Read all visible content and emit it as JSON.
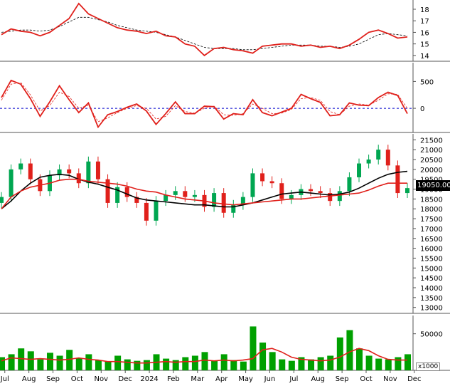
{
  "colors": {
    "price_up": "#00a651",
    "price_down": "#e0201b",
    "ma_short": "#e0201b",
    "ma_long": "#000000",
    "volume": "#00a000",
    "volume_ma": "#e0201b",
    "zero_line": "#0000cc",
    "signal": "#000000"
  },
  "x_axis": {
    "labels": [
      "Jul",
      "Aug",
      "Sep",
      "Oct",
      "Nov",
      "Dec",
      "2024",
      "Feb",
      "Mar",
      "Apr",
      "May",
      "Jun",
      "Jul",
      "Aug",
      "Sep",
      "Oct",
      "Nov",
      "Dec"
    ]
  },
  "chart_data": [
    {
      "type": "line",
      "panel": "indicator-top",
      "y_ticks": [
        "18",
        "17",
        "16",
        "15",
        "14"
      ],
      "ylim": [
        13.5,
        18.8
      ],
      "series": [
        {
          "style": "solid-red",
          "values": [
            15.8,
            16.3,
            16.1,
            16.0,
            15.7,
            16.0,
            16.6,
            17.2,
            18.5,
            17.6,
            17.2,
            16.8,
            16.4,
            16.2,
            16.1,
            15.9,
            16.1,
            15.7,
            15.6,
            15.0,
            14.8,
            14.0,
            14.6,
            14.7,
            14.5,
            14.4,
            14.2,
            14.8,
            14.9,
            15.0,
            15.0,
            14.8,
            14.9,
            14.7,
            14.8,
            14.6,
            14.9,
            15.4,
            16.0,
            16.2,
            15.9,
            15.5,
            15.6
          ]
        },
        {
          "style": "dashed-black",
          "values": [
            16.0,
            16.1,
            16.2,
            16.2,
            16.1,
            16.2,
            16.5,
            16.9,
            17.3,
            17.3,
            17.1,
            16.9,
            16.6,
            16.4,
            16.2,
            16.1,
            16.0,
            15.8,
            15.6,
            15.3,
            15.0,
            14.7,
            14.6,
            14.6,
            14.6,
            14.5,
            14.5,
            14.6,
            14.7,
            14.8,
            14.9,
            14.9,
            14.9,
            14.8,
            14.8,
            14.7,
            14.8,
            15.0,
            15.4,
            15.8,
            15.9,
            15.8,
            15.7
          ]
        }
      ]
    },
    {
      "type": "line",
      "panel": "oscillator",
      "y_ticks": [
        "500",
        "0"
      ],
      "ylim": [
        -450,
        850
      ],
      "zero": 0,
      "series": [
        {
          "style": "solid-red",
          "values": [
            200,
            520,
            450,
            180,
            -150,
            120,
            420,
            160,
            -80,
            100,
            -350,
            -120,
            -60,
            20,
            80,
            -50,
            -300,
            -100,
            120,
            -100,
            -100,
            40,
            30,
            -200,
            -100,
            -120,
            160,
            -80,
            -140,
            -70,
            0,
            260,
            180,
            110,
            -140,
            -120,
            100,
            60,
            50,
            200,
            300,
            240,
            -100
          ]
        },
        {
          "style": "dashed-red",
          "values": [
            150,
            450,
            480,
            250,
            -50,
            50,
            300,
            220,
            0,
            60,
            -250,
            -180,
            -80,
            0,
            50,
            0,
            -200,
            -150,
            50,
            -60,
            -90,
            0,
            40,
            -120,
            -130,
            -100,
            80,
            0,
            -100,
            -90,
            -20,
            180,
            200,
            150,
            -60,
            -120,
            40,
            80,
            60,
            150,
            270,
            260,
            0
          ]
        }
      ]
    },
    {
      "type": "candlestick",
      "panel": "price",
      "y_ticks": [
        "21500",
        "21000",
        "20500",
        "20000",
        "19500",
        "19000",
        "18500",
        "18000",
        "17500",
        "17000",
        "16500",
        "16000",
        "15500",
        "15000",
        "14500",
        "14000",
        "13500",
        "13000"
      ],
      "ylim": [
        12700,
        21800
      ],
      "last_value_label": "19050.00",
      "ma_short": [
        18000,
        18600,
        18900,
        19100,
        19200,
        19300,
        19450,
        19500,
        19500,
        19400,
        19350,
        19300,
        19250,
        19150,
        19000,
        18900,
        18850,
        18700,
        18600,
        18500,
        18450,
        18400,
        18300,
        18250,
        18200,
        18250,
        18300,
        18350,
        18400,
        18450,
        18500,
        18500,
        18550,
        18600,
        18650,
        18700,
        18750,
        18800,
        18950,
        19150,
        19300,
        19300,
        19300
      ],
      "ma_long": [
        18000,
        18400,
        18900,
        19300,
        19600,
        19700,
        19750,
        19700,
        19500,
        19350,
        19250,
        19100,
        18950,
        18750,
        18550,
        18450,
        18400,
        18350,
        18300,
        18250,
        18200,
        18200,
        18150,
        18100,
        18100,
        18200,
        18300,
        18450,
        18600,
        18750,
        18800,
        18850,
        18800,
        18750,
        18700,
        18750,
        18850,
        19050,
        19300,
        19550,
        19750,
        19850,
        19900
      ],
      "closes": [
        18600,
        20000,
        20300,
        19500,
        18900,
        19700,
        20000,
        19800,
        19300,
        20400,
        19500,
        18300,
        19100,
        18600,
        18300,
        17400,
        18400,
        18700,
        18900,
        18600,
        18700,
        18100,
        18800,
        17800,
        18200,
        18600,
        19800,
        19400,
        19300,
        18500,
        18700,
        19000,
        18900,
        18800,
        18400,
        18900,
        19600,
        20300,
        20500,
        21000,
        20200,
        18800,
        19050
      ]
    },
    {
      "type": "bar",
      "panel": "volume",
      "unit": "x1000",
      "y_ticks": [
        "50000"
      ],
      "ylim": [
        0,
        75000
      ],
      "values": [
        18000,
        22000,
        30000,
        26000,
        15000,
        24000,
        20000,
        28000,
        17000,
        22000,
        14000,
        12000,
        20000,
        15000,
        13000,
        14000,
        22000,
        16000,
        14000,
        18000,
        20000,
        25000,
        13000,
        22000,
        14000,
        12000,
        60000,
        38000,
        25000,
        15000,
        13000,
        18000,
        15000,
        18000,
        20000,
        45000,
        55000,
        30000,
        20000,
        16000,
        15000,
        18000,
        22000
      ],
      "ma": [
        13000,
        17000,
        16000,
        15000,
        16000,
        15000,
        14000,
        15000,
        17000,
        15000,
        14000,
        12000,
        12000,
        11000,
        10000,
        10000,
        11000,
        12000,
        11000,
        12000,
        12000,
        14000,
        13000,
        14000,
        13000,
        14000,
        16000,
        28000,
        30000,
        25000,
        18000,
        15000,
        14000,
        13000,
        14000,
        18000,
        25000,
        30000,
        27000,
        20000,
        15000,
        14000,
        14000
      ]
    }
  ]
}
